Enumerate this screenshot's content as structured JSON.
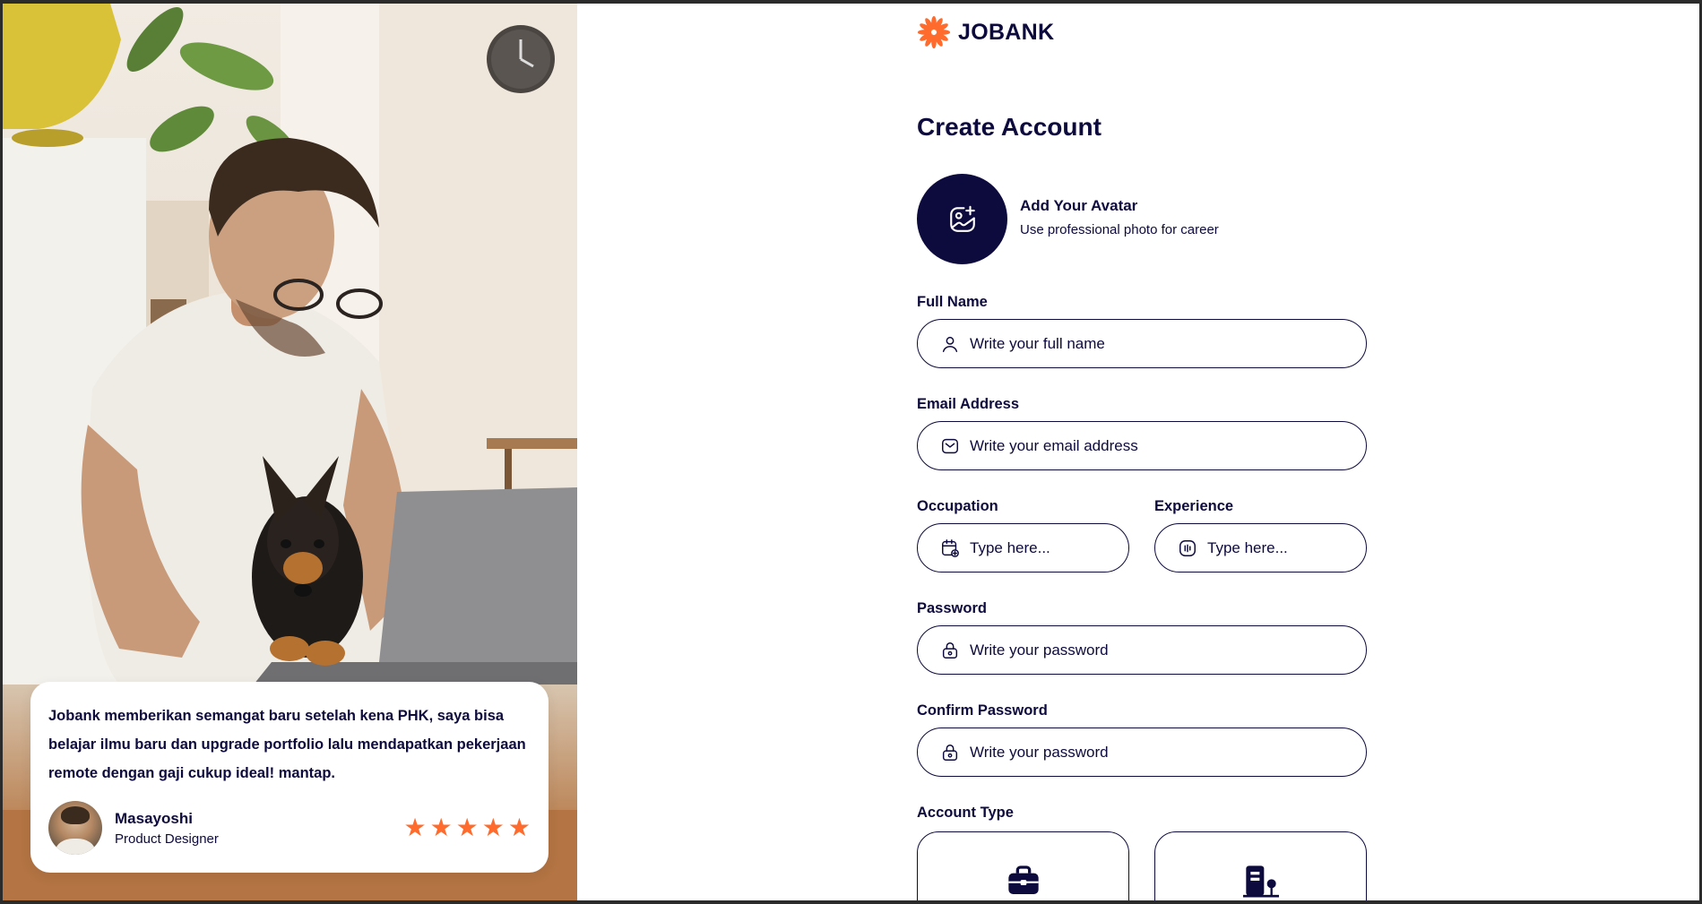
{
  "brand": {
    "name": "JOBANK",
    "accent": "#ff6b2c",
    "primary": "#0d0a3d"
  },
  "review": {
    "text": "Jobank memberikan semangat baru setelah kena PHK, saya bisa belajar ilmu baru dan upgrade portfolio lalu mendapatkan pekerjaan remote dengan gaji cukup ideal! mantap.",
    "name": "Masayoshi",
    "role": "Product Designer",
    "rating": 5
  },
  "form": {
    "title": "Create Account",
    "avatar": {
      "title": "Add Your Avatar",
      "subtitle": "Use professional photo for career"
    },
    "full_name": {
      "label": "Full Name",
      "placeholder": "Write your full name"
    },
    "email": {
      "label": "Email Address",
      "placeholder": "Write your email address"
    },
    "occupation": {
      "label": "Occupation",
      "placeholder": "Type here..."
    },
    "experience": {
      "label": "Experience",
      "placeholder": "Type here..."
    },
    "password": {
      "label": "Password",
      "placeholder": "Write your password"
    },
    "confirm_password": {
      "label": "Confirm Password",
      "placeholder": "Write your password"
    },
    "account_type": {
      "label": "Account Type",
      "options": [
        "briefcase-icon",
        "building-icon"
      ]
    }
  }
}
